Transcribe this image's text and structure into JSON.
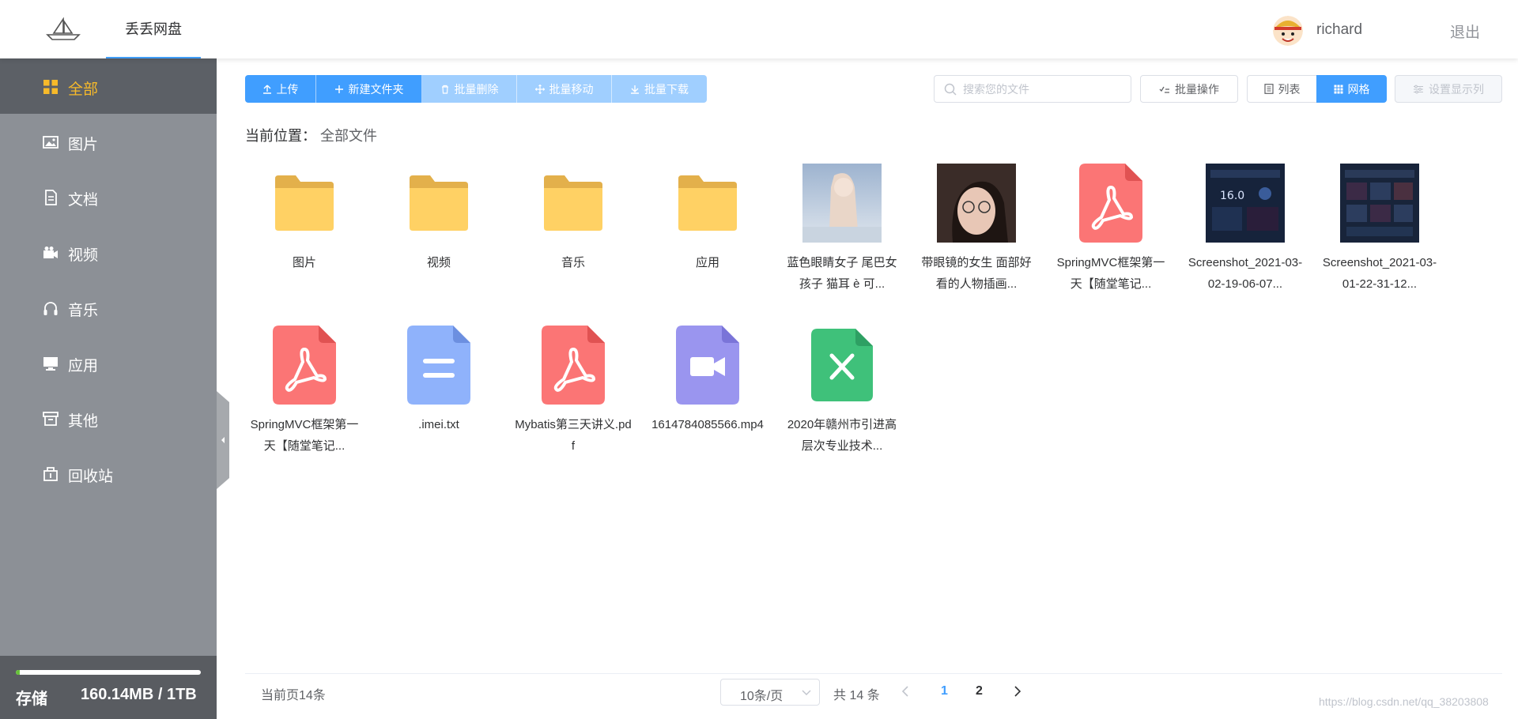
{
  "header": {
    "brand": "丢丢网盘",
    "user_name": "richard",
    "logout": "退出"
  },
  "sidebar": {
    "items": [
      {
        "label": "全部",
        "icon": "grid-icon",
        "active": true
      },
      {
        "label": "图片",
        "icon": "image-icon"
      },
      {
        "label": "文档",
        "icon": "document-icon"
      },
      {
        "label": "视频",
        "icon": "video-camera-icon"
      },
      {
        "label": "音乐",
        "icon": "headphones-icon"
      },
      {
        "label": "应用",
        "icon": "monitor-icon"
      },
      {
        "label": "其他",
        "icon": "archive-box-icon"
      },
      {
        "label": "回收站",
        "icon": "trash-box-icon"
      }
    ],
    "storage": {
      "label": "存储",
      "value": "160.14MB / 1TB",
      "used_fraction": 0.02
    }
  },
  "toolbar": {
    "upload": "上传",
    "new_folder": "新建文件夹",
    "batch_delete": "批量删除",
    "batch_move": "批量移动",
    "batch_download": "批量下载",
    "search_placeholder": "搜索您的文件",
    "batch_ops": "批量操作",
    "list_view": "列表",
    "grid_view": "网格",
    "display_columns": "设置显示列"
  },
  "breadcrumb": {
    "label": "当前位置：",
    "path": "全部文件"
  },
  "files": [
    {
      "name": "图片",
      "type": "folder"
    },
    {
      "name": "视频",
      "type": "folder"
    },
    {
      "name": "音乐",
      "type": "folder"
    },
    {
      "name": "应用",
      "type": "folder"
    },
    {
      "name": "蓝色眼睛女子 尾巴女孩子 猫耳 è 可...",
      "type": "image1"
    },
    {
      "name": "带眼镜的女生 面部好看的人物插画...",
      "type": "image2"
    },
    {
      "name": "SpringMVC框架第一天【随堂笔记...",
      "type": "pdf"
    },
    {
      "name": "Screenshot_2021-03-02-19-06-07...",
      "type": "image3"
    },
    {
      "name": "Screenshot_2021-03-01-22-31-12...",
      "type": "image4"
    },
    {
      "name": "SpringMVC框架第一天【随堂笔记...",
      "type": "pdf"
    },
    {
      "name": ".imei.txt",
      "type": "txt"
    },
    {
      "name": "Mybatis第三天讲义.pdf",
      "type": "pdf"
    },
    {
      "name": "1614784085566.mp4",
      "type": "video"
    },
    {
      "name": "2020年赣州市引进高层次专业技术...",
      "type": "excel"
    }
  ],
  "pagination": {
    "current_count": "当前页14条",
    "page_size": "10条/页",
    "total": "共 14 条",
    "pages": [
      "1",
      "2"
    ],
    "current_page": "1"
  },
  "watermark": "https://blog.csdn.net/qq_38203808"
}
